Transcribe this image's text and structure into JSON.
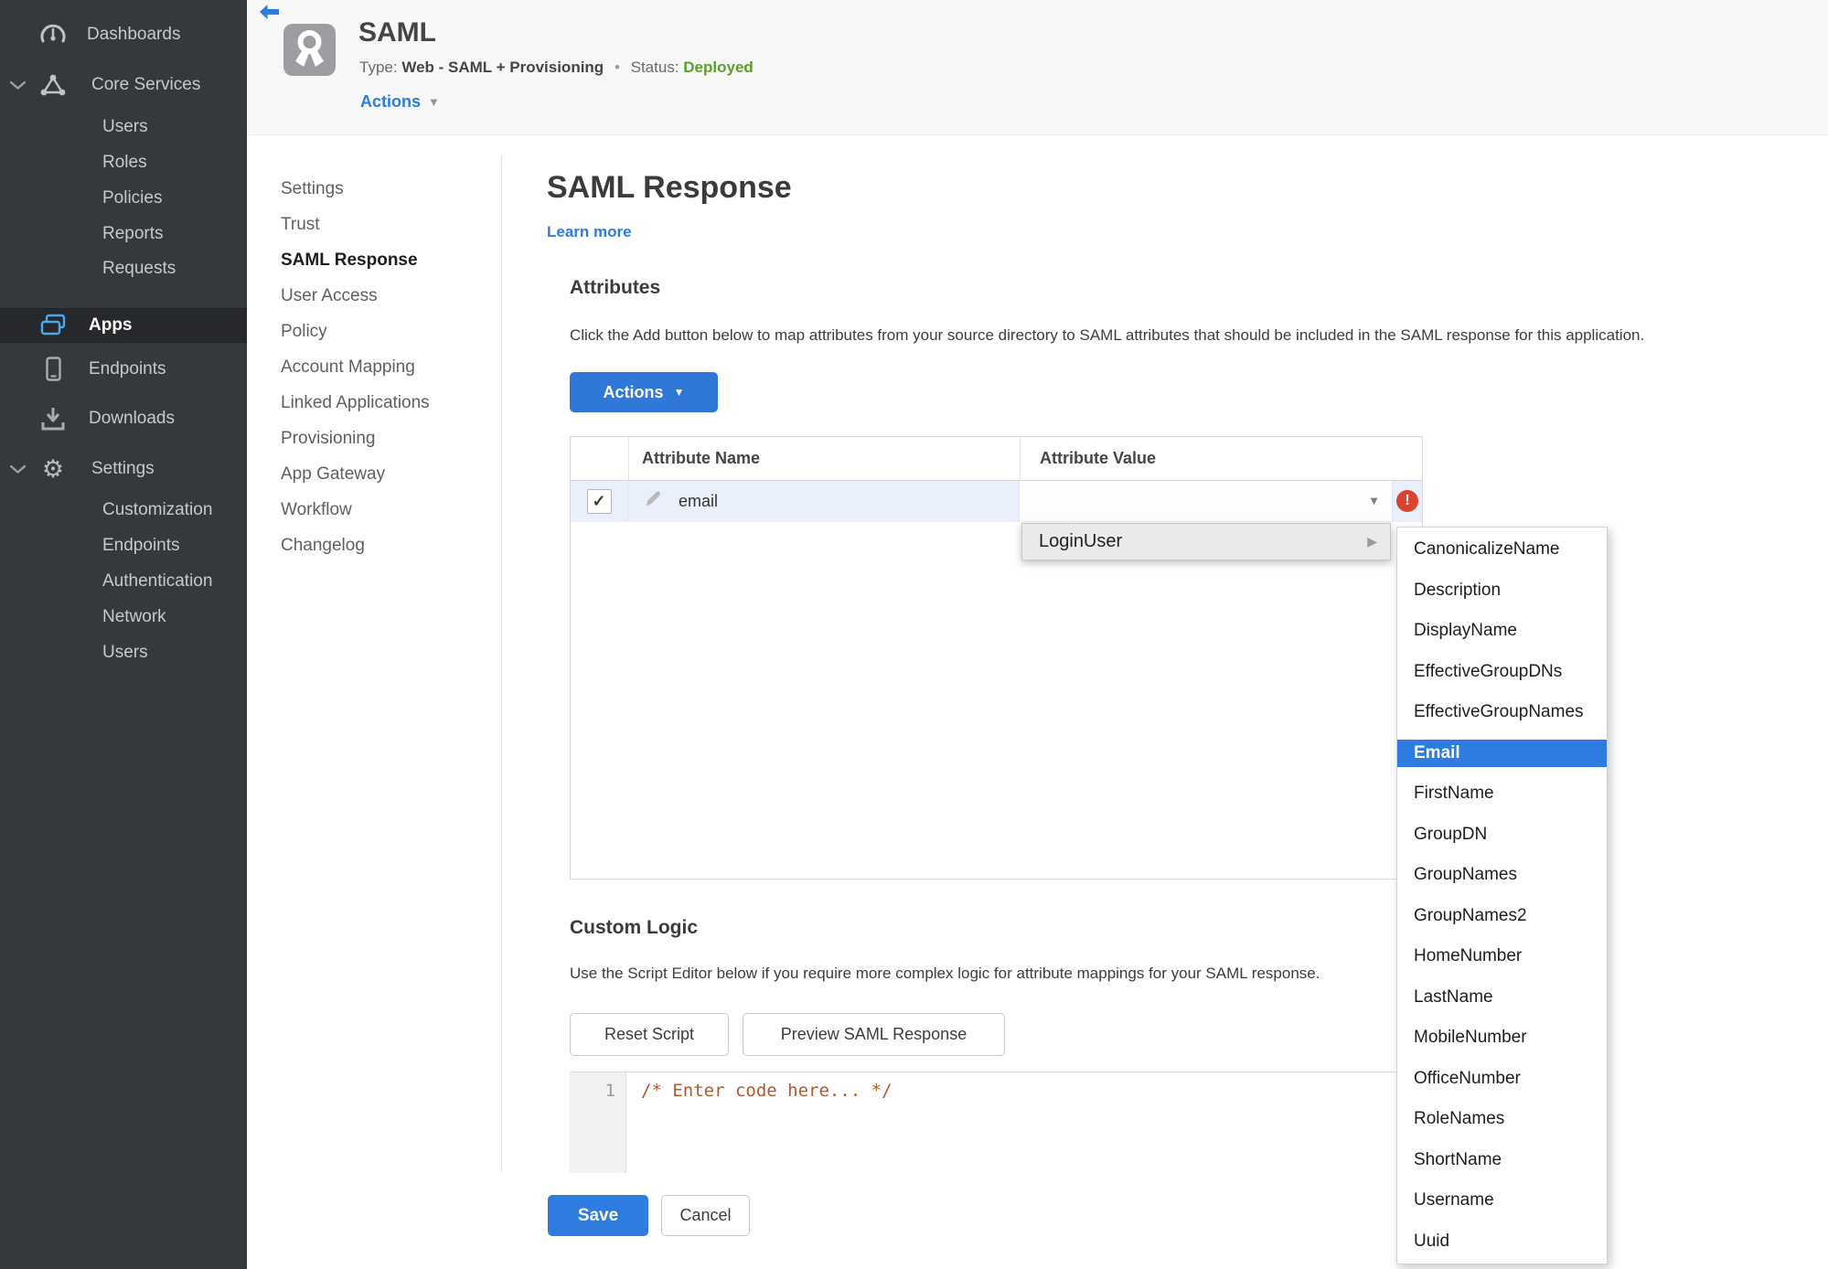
{
  "sidebar": {
    "dashboards": "Dashboards",
    "core_services": "Core Services",
    "core_children": [
      "Users",
      "Roles",
      "Policies",
      "Reports",
      "Requests"
    ],
    "apps": "Apps",
    "endpoints": "Endpoints",
    "downloads": "Downloads",
    "settings": "Settings",
    "settings_children": [
      "Customization",
      "Endpoints",
      "Authentication",
      "Network",
      "Users"
    ]
  },
  "app_header": {
    "title": "SAML",
    "type_label": "Type:",
    "type_value": "Web - SAML + Provisioning",
    "separator": "•",
    "status_label": "Status:",
    "status_value": "Deployed",
    "actions_label": "Actions"
  },
  "subnav": {
    "items": [
      "Settings",
      "Trust",
      "SAML Response",
      "User Access",
      "Policy",
      "Account Mapping",
      "Linked Applications",
      "Provisioning",
      "App Gateway",
      "Workflow",
      "Changelog"
    ],
    "active": "SAML Response"
  },
  "main": {
    "title": "SAML Response",
    "learn_more": "Learn more",
    "attributes": {
      "heading": "Attributes",
      "description": "Click the Add button below to map attributes from your source directory to SAML attributes that should be included in the SAML response for this application.",
      "actions_button": "Actions",
      "table": {
        "columns": [
          "Attribute Name",
          "Attribute Value"
        ],
        "rows": [
          {
            "name": "email",
            "value": "",
            "checked": true,
            "has_error": true
          }
        ]
      }
    },
    "custom_logic": {
      "heading": "Custom Logic",
      "description": "Use the Script Editor below if you require more complex logic for attribute mappings for your SAML response.",
      "reset_button": "Reset Script",
      "preview_button": "Preview SAML Response",
      "editor": {
        "line_number": "1",
        "code": "/* Enter code here... */"
      }
    },
    "save_button": "Save",
    "cancel_button": "Cancel"
  },
  "dropdown": {
    "parent_item": "LoginUser",
    "submenu_items": [
      "CanonicalizeName",
      "Description",
      "DisplayName",
      "EffectiveGroupDNs",
      "EffectiveGroupNames",
      "Email",
      "FirstName",
      "GroupDN",
      "GroupNames",
      "GroupNames2",
      "HomeNumber",
      "LastName",
      "MobileNumber",
      "OfficeNumber",
      "RoleNames",
      "ShortName",
      "Username",
      "Uuid"
    ],
    "selected_item": "Email"
  },
  "icons": {
    "caret_down": "▼",
    "caret_right": "▶",
    "check": "✓",
    "exclamation": "!",
    "gear": "⚙"
  },
  "colors": {
    "accent_blue": "#2e7ce0",
    "status_green": "#5b9e30",
    "error_red": "#d9432f"
  }
}
